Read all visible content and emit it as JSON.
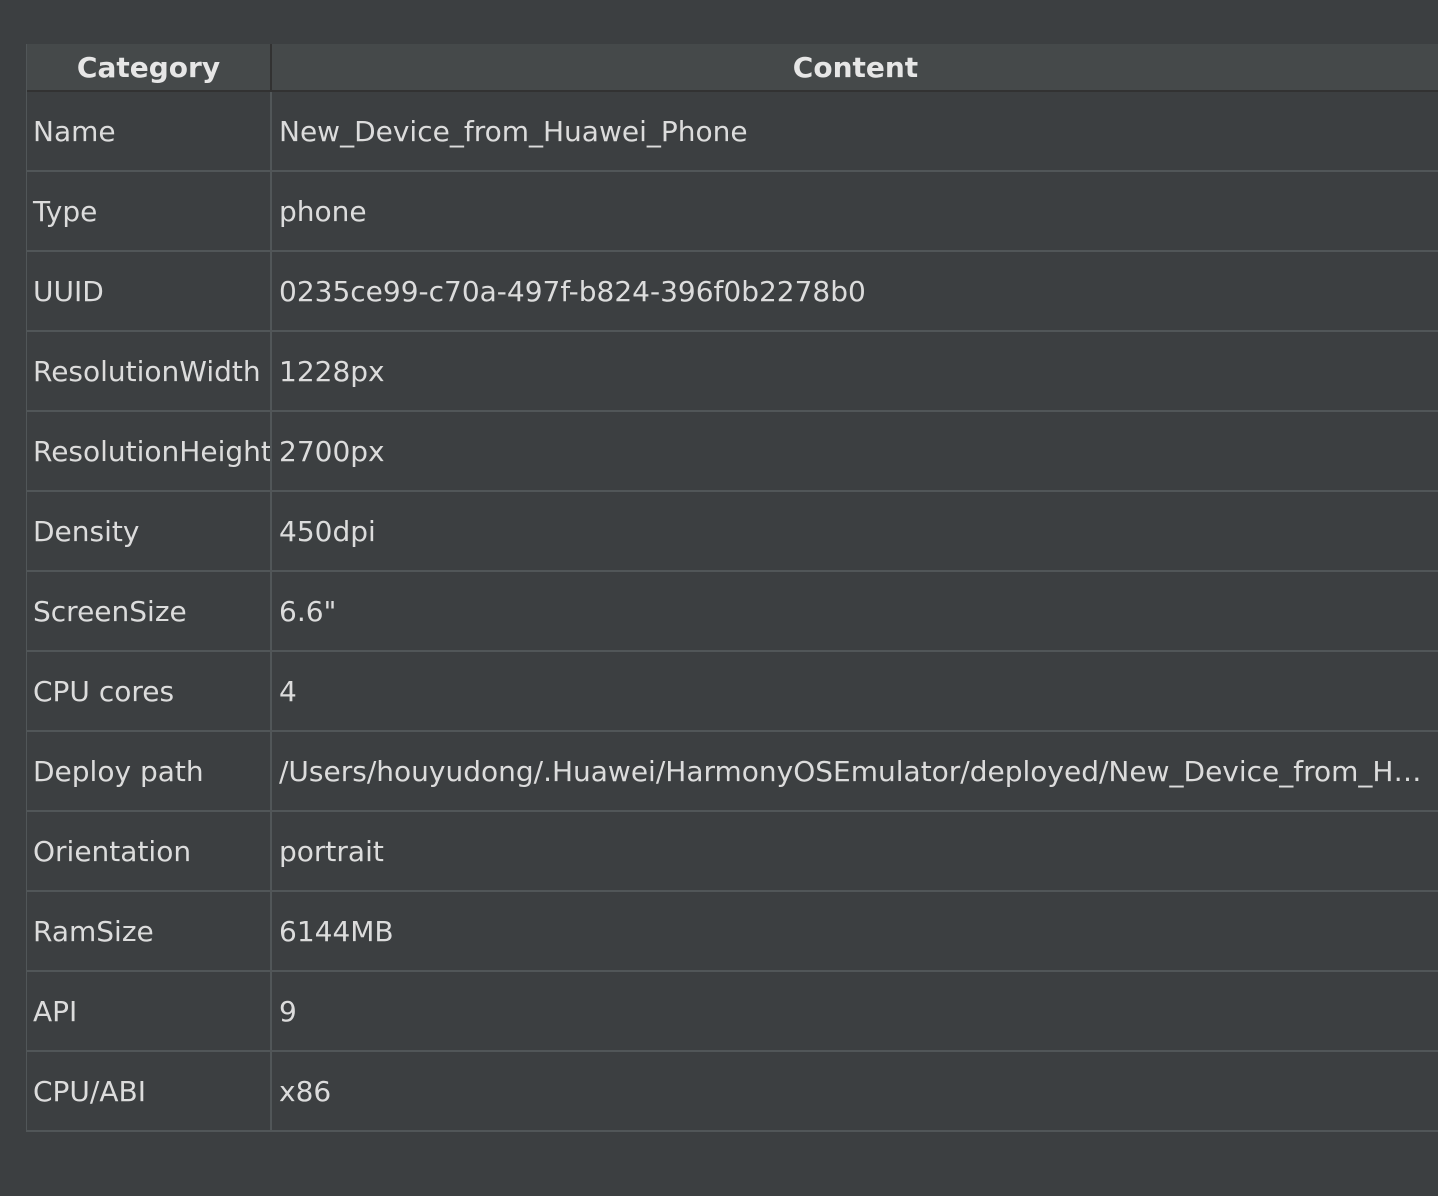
{
  "table": {
    "headers": {
      "category": "Category",
      "content": "Content"
    },
    "rows": [
      {
        "category": "Name",
        "content": "New_Device_from_Huawei_Phone"
      },
      {
        "category": "Type",
        "content": "phone"
      },
      {
        "category": "UUID",
        "content": "0235ce99-c70a-497f-b824-396f0b2278b0"
      },
      {
        "category": "ResolutionWidth",
        "content": "1228px"
      },
      {
        "category": "ResolutionHeight",
        "content": "2700px"
      },
      {
        "category": "Density",
        "content": "450dpi"
      },
      {
        "category": "ScreenSize",
        "content": "6.6\""
      },
      {
        "category": "CPU cores",
        "content": "4"
      },
      {
        "category": "Deploy path",
        "content": "/Users/houyudong/.Huawei/HarmonyOSEmulator/deployed/New_Device_from_Hua..."
      },
      {
        "category": "Orientation",
        "content": "portrait"
      },
      {
        "category": "RamSize",
        "content": "6144MB"
      },
      {
        "category": "API",
        "content": "9"
      },
      {
        "category": "CPU/ABI",
        "content": "x86"
      }
    ]
  }
}
